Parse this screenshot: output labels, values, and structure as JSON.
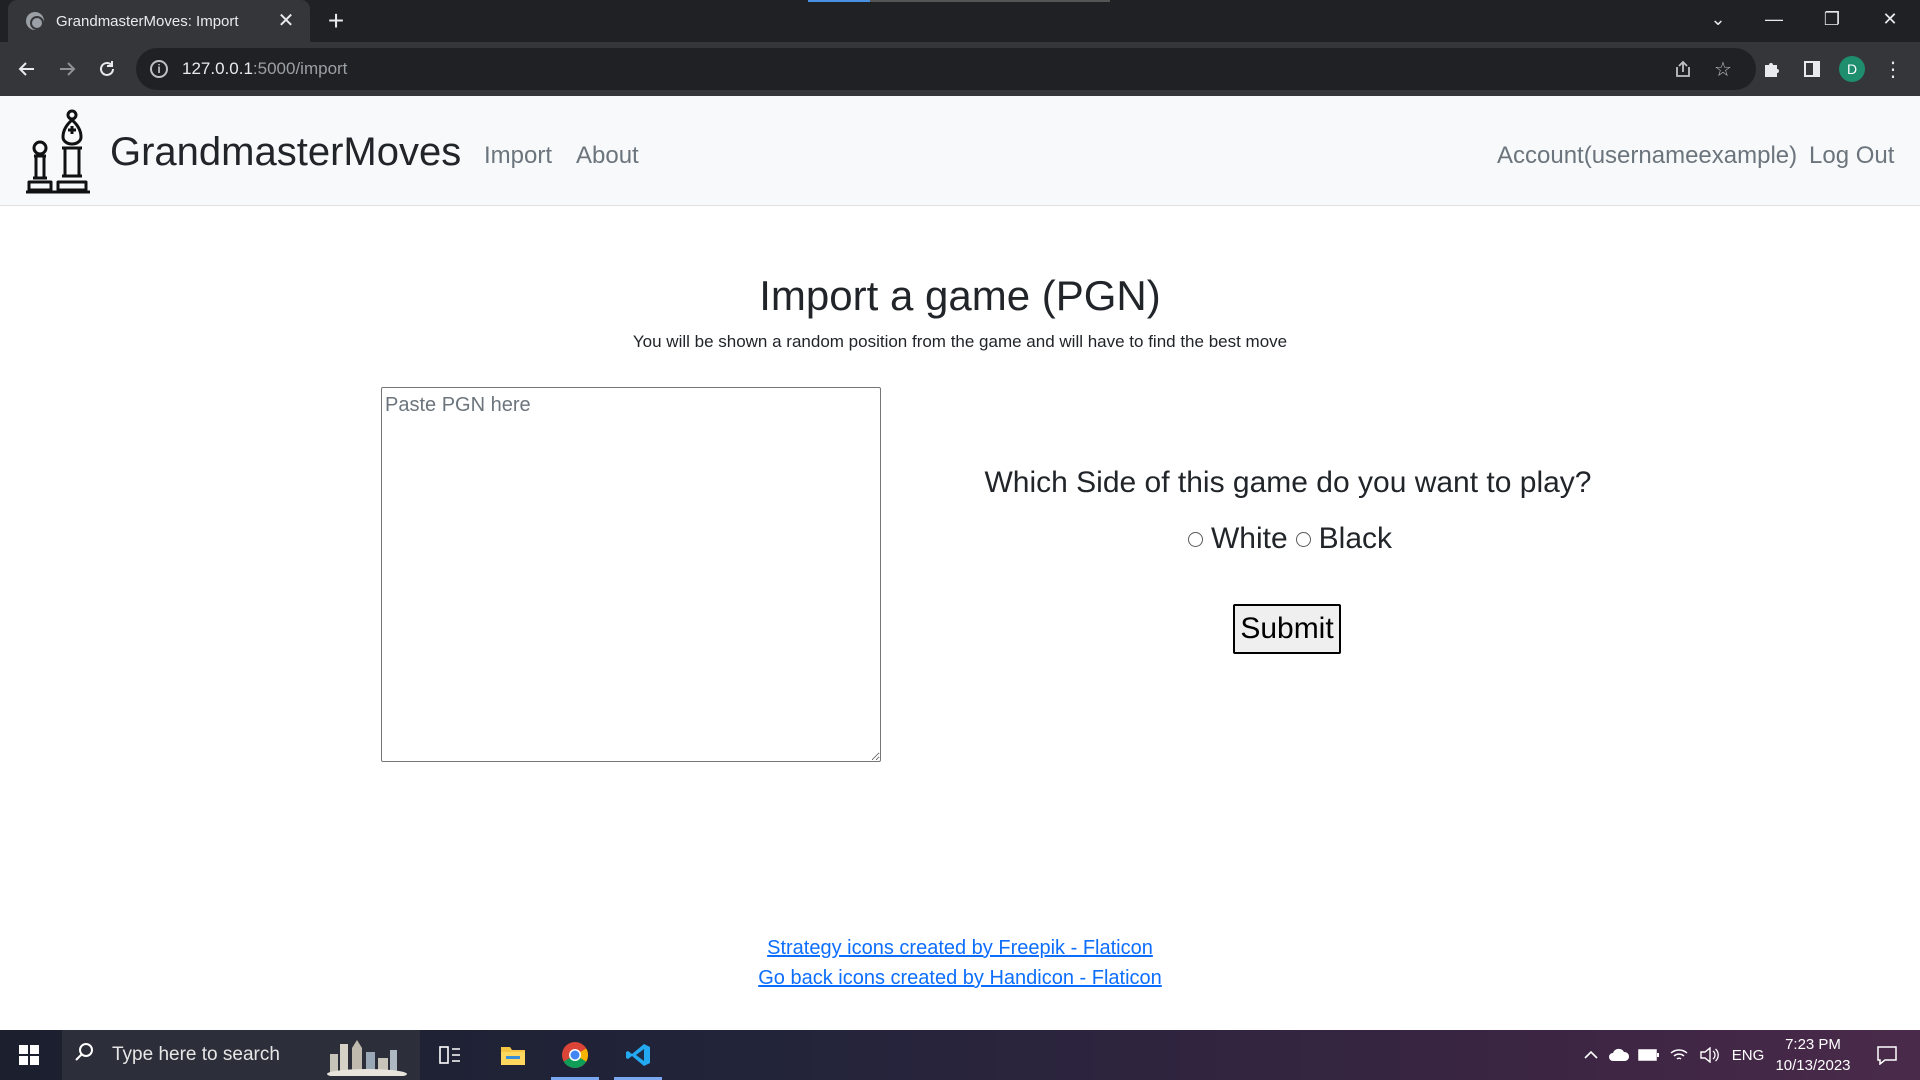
{
  "browser": {
    "tab_title": "GrandmasterMoves: Import",
    "tab_close": "✕",
    "new_tab": "+",
    "url_host": "127.0.0.1",
    "url_path": ":5000/import",
    "profile_initial": "D",
    "window_controls": {
      "tab_search": "⌄",
      "minimize": "—",
      "restore": "❐",
      "close": "✕"
    }
  },
  "navbar": {
    "brand": "GrandmasterMoves",
    "links": {
      "import": "Import",
      "about": "About",
      "account": "Account(usernameexample)",
      "logout": "Log Out"
    }
  },
  "main": {
    "title": "Import a game (PGN)",
    "subtitle": "You will be shown a random position from the game and will have to find the best move",
    "pgn_placeholder": "Paste PGN here",
    "side_question": "Which Side of this game do you want to play?",
    "options": {
      "white": "White",
      "black": "Black"
    },
    "submit_label": "Submit"
  },
  "footer": {
    "credit_1": "Strategy icons created by Freepik - Flaticon",
    "credit_2": "Go back icons created by Handicon - Flaticon"
  },
  "taskbar": {
    "search_placeholder": "Type here to search",
    "language": "ENG",
    "time": "7:23 PM",
    "date": "10/13/2023"
  }
}
